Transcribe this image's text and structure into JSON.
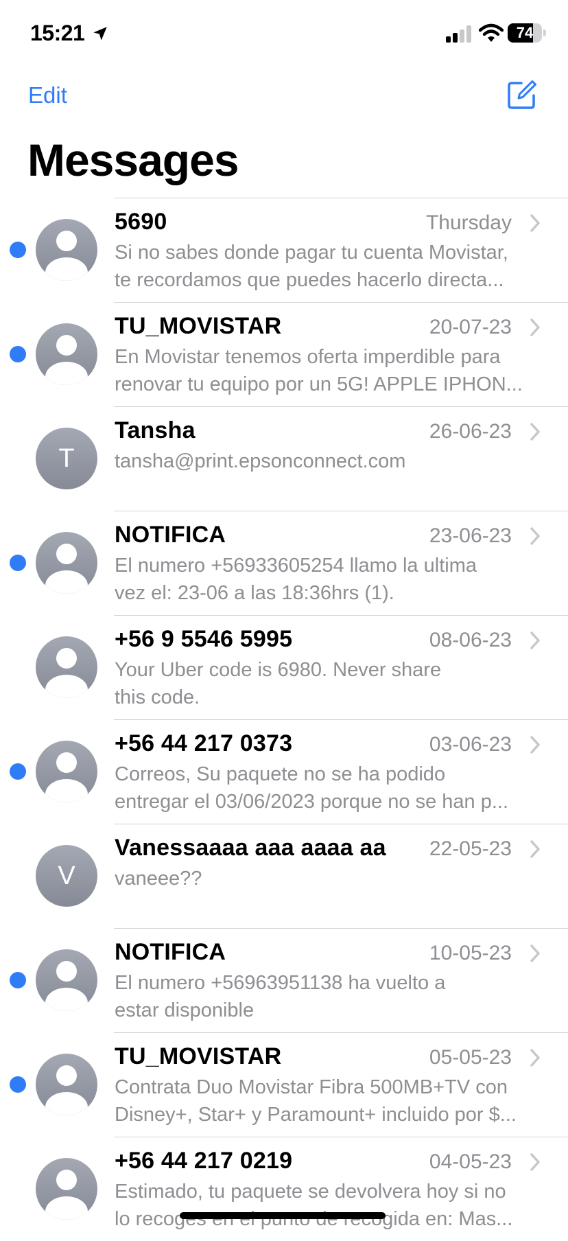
{
  "status_bar": {
    "time": "15:21",
    "battery": "74",
    "battery_level": 0.74,
    "signal_bars": 2,
    "icons": [
      "location-arrow-icon",
      "cellular-signal-icon",
      "wifi-icon",
      "battery-icon"
    ]
  },
  "nav": {
    "edit_label": "Edit",
    "compose_icon": "compose-icon",
    "title": "Messages"
  },
  "colors": {
    "accent": "#2f7cf6",
    "secondary_text": "#8e8e93",
    "separator": "#d1d1d6",
    "avatar": "#9a9ea9"
  },
  "conversations": [
    {
      "sender": "5690",
      "date": "Thursday",
      "unread": true,
      "avatar": "person-icon",
      "preview_line1": "Si no sabes donde pagar tu cuenta Movistar,",
      "preview_line2": "te recordamos que puedes hacerlo directa..."
    },
    {
      "sender": "TU_MOVISTAR",
      "date": "20-07-23",
      "unread": true,
      "avatar": "person-icon",
      "preview_line1": "En Movistar tenemos oferta imperdible para",
      "preview_line2": "renovar tu equipo por un 5G! APPLE IPHON..."
    },
    {
      "sender": "Tansha",
      "date": "26-06-23",
      "unread": false,
      "avatar_initial": "T",
      "preview_line1": "tansha@print.epsonconnect.com",
      "preview_line2": ""
    },
    {
      "sender": "NOTIFICA",
      "date": "23-06-23",
      "unread": true,
      "avatar": "person-icon",
      "preview_line1": "El numero +56933605254 llamo la ultima",
      "preview_line2": "vez el: 23-06 a las 18:36hrs (1)."
    },
    {
      "sender": "+56 9 5546 5995",
      "date": "08-06-23",
      "unread": false,
      "avatar": "person-icon",
      "preview_line1": "Your Uber code is 6980. Never share",
      "preview_line2": "this code."
    },
    {
      "sender": "+56 44 217 0373",
      "date": "03-06-23",
      "unread": true,
      "avatar": "person-icon",
      "preview_line1": "Correos, Su paquete no se ha podido",
      "preview_line2": "entregar el 03/06/2023 porque no se han p..."
    },
    {
      "sender": "Vanessaaaa aaa aaaa aa",
      "date": "22-05-23",
      "unread": false,
      "avatar_initial": "V",
      "preview_line1": "vaneee??",
      "preview_line2": ""
    },
    {
      "sender": "NOTIFICA",
      "date": "10-05-23",
      "unread": true,
      "avatar": "person-icon",
      "preview_line1": "El numero +56963951138 ha vuelto a",
      "preview_line2": "estar disponible"
    },
    {
      "sender": "TU_MOVISTAR",
      "date": "05-05-23",
      "unread": true,
      "avatar": "person-icon",
      "preview_line1": "Contrata Duo Movistar Fibra 500MB+TV con",
      "preview_line2": "Disney+, Star+ y Paramount+ incluido por $..."
    },
    {
      "sender": "+56 44 217 0219",
      "date": "04-05-23",
      "unread": false,
      "avatar": "person-icon",
      "preview_line1": "Estimado, tu paquete se devolvera hoy si no",
      "preview_line2": "lo recoges en el punto de recogida en: Mas..."
    }
  ]
}
